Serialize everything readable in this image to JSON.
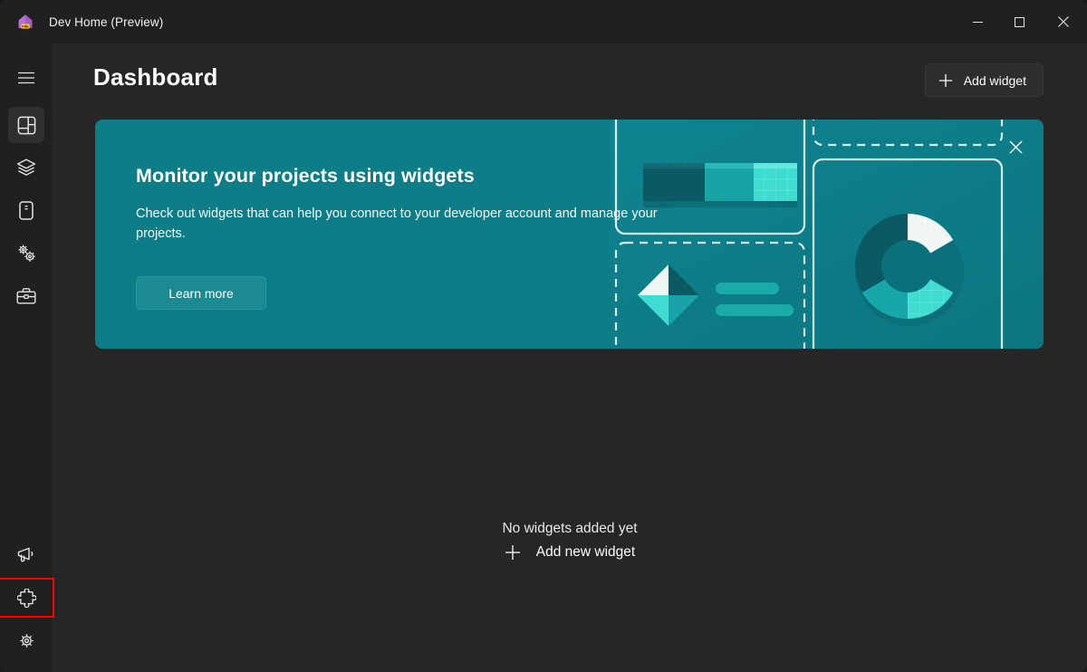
{
  "window": {
    "title": "Dev Home (Preview)",
    "app_icon": "dev-home-house-icon",
    "badge_text": "PRE",
    "controls": {
      "minimize": "minimize-icon",
      "maximize": "maximize-icon",
      "close": "close-icon"
    }
  },
  "sidebar": {
    "menu_button": "hamburger-menu-icon",
    "items": [
      {
        "id": "dashboard",
        "icon": "dashboard-icon",
        "selected": true
      },
      {
        "id": "machine-configuration",
        "icon": "layers-icon",
        "selected": false
      },
      {
        "id": "environments",
        "icon": "device-icon",
        "selected": false
      },
      {
        "id": "utilities",
        "icon": "gears-icon",
        "selected": false
      },
      {
        "id": "toolbox",
        "icon": "briefcase-icon",
        "selected": false
      }
    ],
    "bottom_items": [
      {
        "id": "feedback",
        "icon": "megaphone-icon",
        "highlighted": false
      },
      {
        "id": "extensions",
        "icon": "puzzle-piece-icon",
        "highlighted": true
      },
      {
        "id": "settings",
        "icon": "gear-icon",
        "highlighted": false
      }
    ],
    "highlight_color": "#ff0000",
    "selection_color": "#9ad6dd"
  },
  "header": {
    "title": "Dashboard",
    "add_widget_label": "Add widget",
    "add_widget_icon": "plus-icon"
  },
  "banner": {
    "title": "Monitor your projects using widgets",
    "description": "Check out widgets that can help you connect to your developer account and manage your projects.",
    "learn_more_label": "Learn more",
    "close_icon": "close-icon",
    "background_color": "#0d7d88",
    "button_color": "#1b8a93"
  },
  "empty_state": {
    "title": "No widgets added yet",
    "add_label": "Add new widget",
    "add_icon": "plus-icon"
  }
}
